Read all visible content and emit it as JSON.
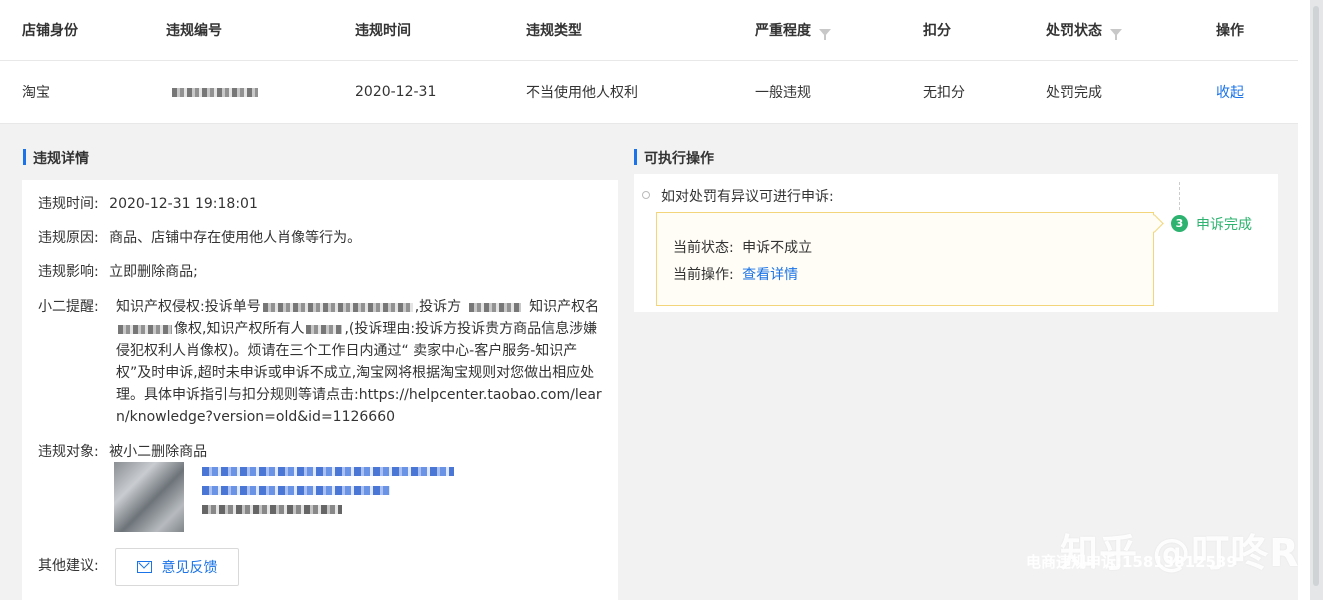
{
  "table": {
    "headers": [
      "店铺身份",
      "违规编号",
      "违规时间",
      "违规类型",
      "严重程度",
      "扣分",
      "处罚状态",
      "操作"
    ],
    "row": {
      "shop_identity": "淘宝",
      "violation_time": "2020-12-31",
      "violation_type": "不当使用他人权利",
      "severity": "一般违规",
      "deduction": "无扣分",
      "penalty_status": "处罚完成",
      "action": "收起"
    }
  },
  "details": {
    "title": "违规详情",
    "time_label": "违规时间:",
    "time_value": "2020-12-31 19:18:01",
    "reason_label": "违规原因:",
    "reason_value": "商品、店铺中存在使用他人肖像等行为。",
    "impact_label": "违规影响:",
    "impact_value": "立即删除商品;",
    "reminder_label": "小二提醒:",
    "reminder_part1": "知识产权侵权:投诉单号",
    "reminder_part2": ",投诉方",
    "reminder_part3": "知识产权名",
    "reminder_part4": "像权,知识产权所有人",
    "reminder_part5": ",(投诉理由:投诉方投诉贵方商品信息涉嫌侵犯权利人肖像权)。烦请在三个工作日内通过“ 卖家中心-客户服务-知识产权”及时申诉,超时未申诉或申诉不成立,淘宝网将根据淘宝规则对您做出相应处理。具体申诉指引与扣分规则等请点击:https://helpcenter.taobao.com/learn/knowledge?version=old&id=1126660",
    "object_label": "违规对象:",
    "object_value": "被小二删除商品",
    "suggestion_label": "其他建议:",
    "feedback_button": "意见反馈"
  },
  "actions": {
    "title": "可执行操作",
    "appeal_prompt": "如对处罚有异议可进行申诉:",
    "status_label": "当前状态:",
    "status_value": "申诉不成立",
    "operation_label": "当前操作:",
    "operation_link": "查看详情",
    "step_number": "3",
    "step_label": "申诉完成"
  },
  "watermark": {
    "main": "知乎 @叮咚R",
    "sub": "电商违规申诉:15813812539"
  },
  "colors": {
    "accent": "#1a73e8",
    "success": "#2db36f",
    "notice_border": "#f3d67b"
  }
}
